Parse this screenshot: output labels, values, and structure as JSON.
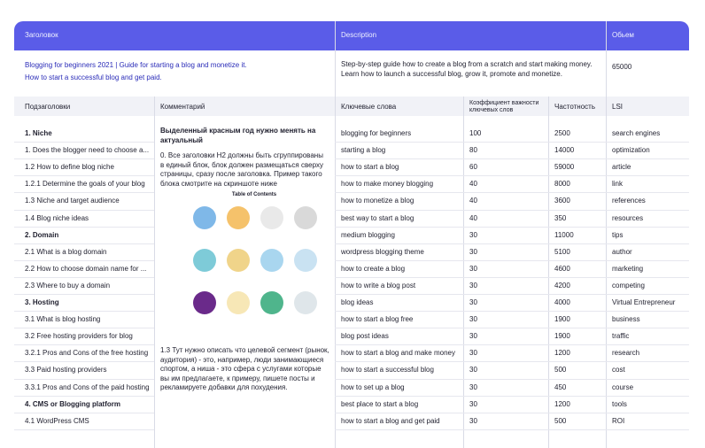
{
  "header": {
    "col1": "Заголовок",
    "col2": "Description",
    "col3": "Обьем"
  },
  "title_block": {
    "title": "Blogging for beginners 2021 | Guide for starting a blog and monetize it.",
    "subtitle": "How to start a successful blog and get paid.",
    "description": "Step-by-step guide how to create a blog from a scratch and start making money. Learn how to launch a successful blog, grow it, promote and monetize.",
    "volume": "65000"
  },
  "columns": {
    "subheadings": "Подзаголовки",
    "comment": "Комментарий",
    "keywords": "Ключевые слова",
    "importance": "Коэффициент важности ключевых слов",
    "frequency": "Частотность",
    "lsi": "LSI"
  },
  "comment": {
    "highlight": "Выделенный красным год нужно менять на актуальный",
    "note0": "0. Все заголовки H2 должны быть сгруппированы в единый блок, блок должен размещаться сверху страницы, сразу после заголовка. Пример такого блока смотрите на скриншоте ниже",
    "infographic_title": "Table of Contents",
    "note13": "1.3 Тут нужно описать что целевой сегмент (рынок, аудитория) - это, например, люди занимающиеся спортом, а ниша - это сфера с услугами которые вы им предлагаете, к примеру, пишете посты и рекламируете добавки для похудения."
  },
  "infographic_circles": [
    "#7fb8e8",
    "#f5c26b",
    "#e9e9e9",
    "#d9d9d9",
    "#7ecbd8",
    "#f0d48a",
    "#a9d6ef",
    "#c9e2f2",
    "#6a2a8a",
    "#f7e7b6",
    "#4fb58c",
    "#dfe6ea"
  ],
  "subheadings": [
    {
      "text": "1. Niche",
      "bold": true
    },
    {
      "text": "1. Does the blogger need to choose a...",
      "bold": false
    },
    {
      "text": "1.2 How to define blog niche",
      "bold": false
    },
    {
      "text": "1.2.1 Determine the goals of your blog",
      "bold": false
    },
    {
      "text": "1.3 Niche and target audience",
      "bold": false
    },
    {
      "text": "1.4 Blog niche ideas",
      "bold": false
    },
    {
      "text": "2. Domain",
      "bold": true
    },
    {
      "text": "2.1 What is a blog domain",
      "bold": false
    },
    {
      "text": "2.2 How to choose domain name for ...",
      "bold": false
    },
    {
      "text": "2.3 Where to buy a domain",
      "bold": false
    },
    {
      "text": "3. Hosting",
      "bold": true
    },
    {
      "text": "3.1 What is blog hosting",
      "bold": false
    },
    {
      "text": "3.2 Free hosting providers for blog",
      "bold": false
    },
    {
      "text": "3.2.1 Pros and Cons of the free hosting",
      "bold": false
    },
    {
      "text": "3.3 Paid hosting providers",
      "bold": false
    },
    {
      "text": "3.3.1 Pros and Cons of the paid hosting",
      "bold": false
    },
    {
      "text": "4. CMS or Blogging platform",
      "bold": true
    },
    {
      "text": "4.1 WordPress CMS",
      "bold": false
    }
  ],
  "keywords": [
    {
      "kw": "blogging for beginners",
      "imp": "100",
      "freq": "2500",
      "lsi": "search engines"
    },
    {
      "kw": "starting a blog",
      "imp": "80",
      "freq": "14000",
      "lsi": "optimization"
    },
    {
      "kw": "how to start a blog",
      "imp": "60",
      "freq": "59000",
      "lsi": "article"
    },
    {
      "kw": "how to make money blogging",
      "imp": "40",
      "freq": "8000",
      "lsi": "link"
    },
    {
      "kw": "how to monetize a blog",
      "imp": "40",
      "freq": "3600",
      "lsi": "references"
    },
    {
      "kw": "best way to start a blog",
      "imp": "40",
      "freq": "350",
      "lsi": "resources"
    },
    {
      "kw": "medium blogging",
      "imp": "30",
      "freq": "11000",
      "lsi": "tips"
    },
    {
      "kw": "wordpress blogging theme",
      "imp": "30",
      "freq": "5100",
      "lsi": "author"
    },
    {
      "kw": "how to create a blog",
      "imp": "30",
      "freq": "4600",
      "lsi": "marketing"
    },
    {
      "kw": "how to write a blog post",
      "imp": "30",
      "freq": "4200",
      "lsi": "competing"
    },
    {
      "kw": "blog ideas",
      "imp": "30",
      "freq": "4000",
      "lsi": "Virtual Entrepreneur"
    },
    {
      "kw": "how to start a blog free",
      "imp": "30",
      "freq": "1900",
      "lsi": "business"
    },
    {
      "kw": "blog post ideas",
      "imp": "30",
      "freq": "1900",
      "lsi": "traffic"
    },
    {
      "kw": "how to start a blog and make money",
      "imp": "30",
      "freq": "1200",
      "lsi": "research"
    },
    {
      "kw": "how to start a successful blog",
      "imp": "30",
      "freq": "500",
      "lsi": "cost"
    },
    {
      "kw": "how to set up a blog",
      "imp": "30",
      "freq": "450",
      "lsi": "course"
    },
    {
      "kw": "best place to start a blog",
      "imp": "30",
      "freq": "1200",
      "lsi": "tools"
    },
    {
      "kw": "how to start a blog and get paid",
      "imp": "30",
      "freq": "500",
      "lsi": "ROI"
    }
  ]
}
